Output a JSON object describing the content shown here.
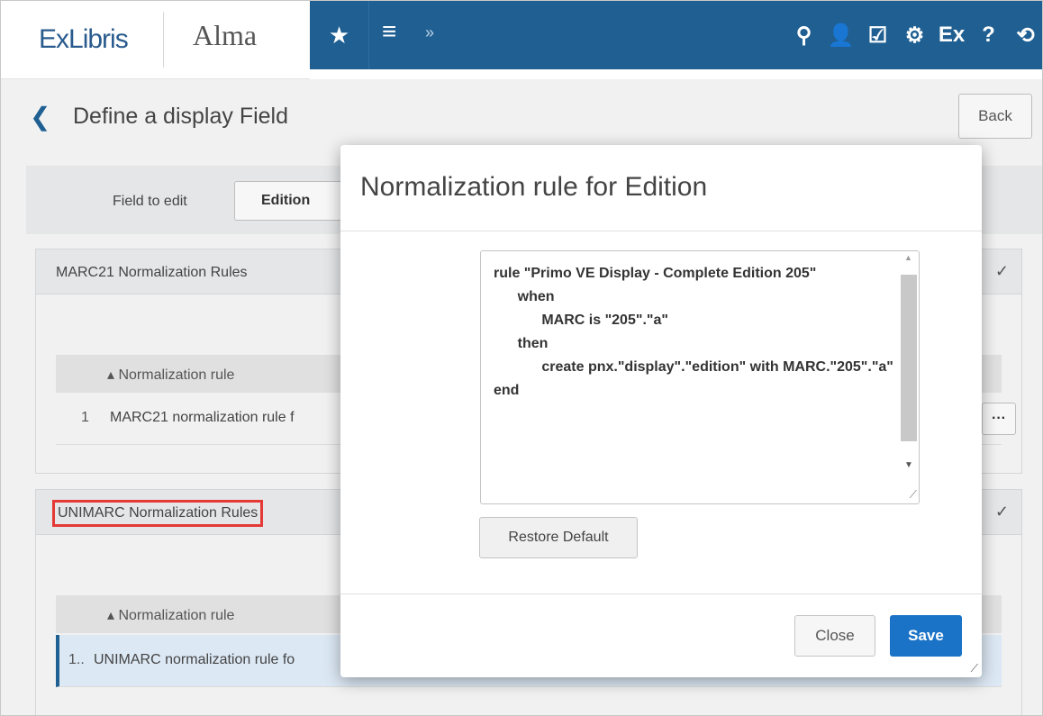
{
  "brand": {
    "vendor": "ExLibris",
    "product": "Alma"
  },
  "navbar": {
    "bg_color": "#1f5f92",
    "star": "★",
    "menu": "≡",
    "menu_chevron": "»",
    "icons": [
      {
        "name": "location-icon",
        "glyph": "⚲"
      },
      {
        "name": "user-icon",
        "glyph": "👤"
      },
      {
        "name": "tasks-icon",
        "glyph": "☑"
      },
      {
        "name": "settings-icon",
        "glyph": "⚙"
      },
      {
        "name": "exlibris-icon",
        "glyph": "Ex"
      },
      {
        "name": "help-icon",
        "glyph": "?"
      },
      {
        "name": "history-icon",
        "glyph": "⟲"
      }
    ]
  },
  "page": {
    "title": "Define a display Field",
    "back_label": "Back",
    "field_label": "Field to edit",
    "field_value": "Edition"
  },
  "sections": {
    "marc21": {
      "title": "MARC21 Normalization Rules",
      "column": "▴ Normalization rule",
      "row_num": "1",
      "row_text": "MARC21 normalization rule f",
      "more": "···"
    },
    "unimarc": {
      "title": "UNIMARC Normalization Rules",
      "column": "▴ Normalization rule",
      "row_num": "1..",
      "row_text": "UNIMARC normalization rule fo"
    }
  },
  "modal": {
    "title": "Normalization rule for Edition",
    "code": "rule \"Primo VE Display - Complete Edition 205\"\n      when\n            MARC is \"205\".\"a\"\n      then\n            create pnx.\"display\".\"edition\" with MARC.\"205\".\"a\"\nend",
    "restore_label": "Restore Default",
    "close_label": "Close",
    "save_label": "Save",
    "save_color": "#1a73c7"
  }
}
